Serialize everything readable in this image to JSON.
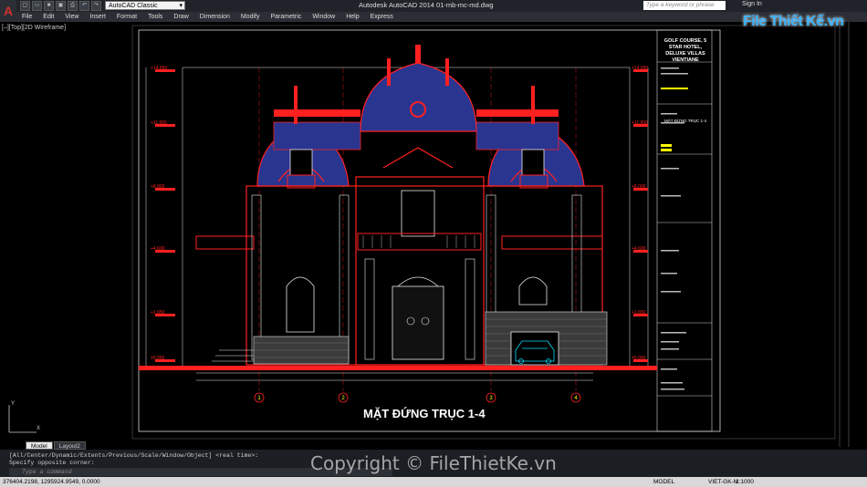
{
  "title_bar": {
    "workspace": "AutoCAD Classic",
    "app_title": "Autodesk AutoCAD 2014    01-mb-mc-md.dwg",
    "search_placeholder": "Type a keyword or phrase",
    "sign_in": "Sign In"
  },
  "menu": [
    "File",
    "Edit",
    "View",
    "Insert",
    "Format",
    "Tools",
    "Draw",
    "Dimension",
    "Modify",
    "Parametric",
    "Window",
    "Help",
    "Express"
  ],
  "viewport_label": "[–][Top][2D Wireframe]",
  "drawing": {
    "title": "MẶT ĐỨNG TRỤC 1-4",
    "grid_axes": [
      "1",
      "2",
      "3",
      "4"
    ],
    "levels_left": [
      "+14,650",
      "+11,650",
      "+8,000",
      "+4,600",
      "+1,650",
      "±0,000"
    ],
    "levels_right": [
      "+14,650",
      "+11,650",
      "+8,000",
      "+4,600",
      "+1,650",
      "±0,000"
    ],
    "title_block": {
      "project": "GOLF COURSE, 5 STAR HOTEL, DELUXE VILLAS VIENTIANE",
      "sheet_label": "MẶT ĐỨNG TRỤC 1-4"
    }
  },
  "command": {
    "line1": "[All/Center/Dynamic/Extents/Previous/Scale/Window/Object] <real time>:",
    "line2": "Specify opposite corner:",
    "input_placeholder": "Type a command"
  },
  "layout_tabs": [
    "Model",
    "Layout2"
  ],
  "status_bar": {
    "coords": "376404.2198, 1295924.9549, 0.0000",
    "model": "MODEL",
    "workspace": "VIET-GK-M",
    "scale": "1:1000"
  },
  "watermark": {
    "logo_text": "File Thiết Kế.vn",
    "copyright": "Copyright © FileThietKe.vn"
  },
  "colors": {
    "drawing_red": "#ff2020",
    "roof_blue": "#3040a0",
    "white_lines": "#e8e8e8",
    "cyan": "#00e0ff",
    "yellow": "#ffff00"
  }
}
